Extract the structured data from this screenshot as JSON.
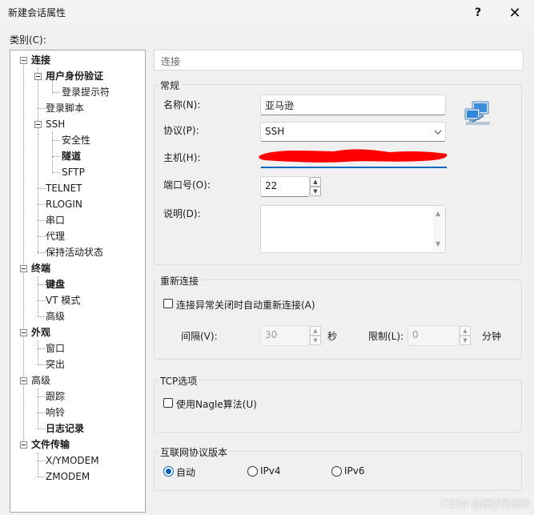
{
  "window": {
    "title": "新建会话属性",
    "help": "?",
    "close": "✕"
  },
  "category_label": "类别(C):",
  "tree": {
    "connection": "连接",
    "user_auth": "用户身份验证",
    "login_prompt": "登录提示符",
    "login_script": "登录脚本",
    "ssh": "SSH",
    "security": "安全性",
    "tunnel": "隧道",
    "sftp": "SFTP",
    "telnet": "TELNET",
    "rlogin": "RLOGIN",
    "serial": "串口",
    "proxy": "代理",
    "keepalive": "保持活动状态",
    "terminal": "终端",
    "keyboard": "键盘",
    "vt_mode": "VT 模式",
    "terminal_advanced": "高级",
    "appearance": "外观",
    "window": "窗口",
    "highlight": "突出",
    "advanced": "高级",
    "trace": "跟踪",
    "bell": "响铃",
    "log": "日志记录",
    "file_transfer": "文件传输",
    "xymodem": "X/YMODEM",
    "zmodem": "ZMODEM"
  },
  "breadcrumb": "连接",
  "general": {
    "legend": "常规",
    "name_label": "名称(N):",
    "name_value": "亚马逊",
    "protocol_label": "协议(P):",
    "protocol_value": "SSH",
    "host_label": "主机(H):",
    "port_label": "端口号(O):",
    "port_value": "22",
    "desc_label": "说明(D):"
  },
  "reconnect": {
    "legend": "重新连接",
    "auto_label": "连接异常关闭时自动重新连接(A)",
    "interval_label": "间隔(V):",
    "interval_value": "30",
    "interval_unit": "秒",
    "limit_label": "限制(L):",
    "limit_value": "0",
    "limit_unit": "分钟"
  },
  "tcp": {
    "legend": "TCP选项",
    "nagle_label": "使用Nagle算法(U)"
  },
  "ipver": {
    "legend": "互联网协议版本",
    "opt_auto": "自动",
    "opt_ipv4": "IPv4",
    "opt_ipv6": "IPv6",
    "selected": "自动"
  },
  "watermark": "CSDN @程序员洲洲",
  "colors": {
    "accent": "#005fb8",
    "redaction": "#ff0000"
  }
}
